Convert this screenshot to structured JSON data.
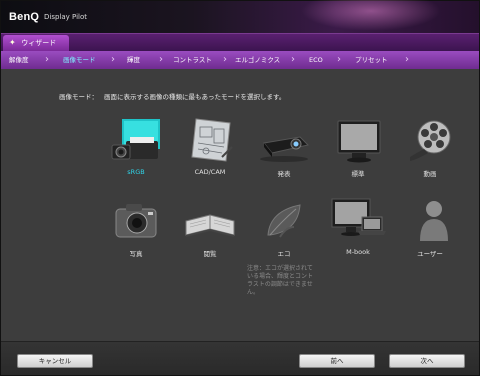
{
  "app": {
    "brand": "BenQ",
    "title": "Display Pilot"
  },
  "wizard": {
    "label": "ウィザード"
  },
  "steps": [
    {
      "label": "解像度",
      "active": false
    },
    {
      "label": "画像モード",
      "active": true
    },
    {
      "label": "輝度",
      "active": false
    },
    {
      "label": "コントラスト",
      "active": false
    },
    {
      "label": "エルゴノミクス",
      "active": false
    },
    {
      "label": "ECO",
      "active": false
    },
    {
      "label": "プリセット",
      "active": false
    }
  ],
  "instruction": {
    "label": "画像モード：",
    "text": "画面に表示する画像の種類に最もあったモードを選択します。"
  },
  "modes": [
    {
      "name": "sRGB",
      "icon": "printer-camera-icon",
      "selected": true
    },
    {
      "name": "CAD/CAM",
      "icon": "blueprint-icon",
      "selected": false
    },
    {
      "name": "発表",
      "icon": "projector-icon",
      "selected": false
    },
    {
      "name": "標準",
      "icon": "monitor-icon",
      "selected": false
    },
    {
      "name": "動画",
      "icon": "film-reel-icon",
      "selected": false
    },
    {
      "name": "写真",
      "icon": "camera-icon",
      "selected": false
    },
    {
      "name": "閲覧",
      "icon": "book-icon",
      "selected": false
    },
    {
      "name": "エコ",
      "icon": "leaf-icon",
      "selected": false
    },
    {
      "name": "M-book",
      "icon": "monitor-laptop-icon",
      "selected": false
    },
    {
      "name": "ユーザー",
      "icon": "user-icon",
      "selected": false
    }
  ],
  "note": "注意：エコが選択されている場合、輝度とコントラストの調節はできません。",
  "footer": {
    "cancel": "キャンセル",
    "prev": "前へ",
    "next": "次へ"
  },
  "colors": {
    "accent": "#2fd4e8",
    "purple": "#8a3fb0"
  }
}
